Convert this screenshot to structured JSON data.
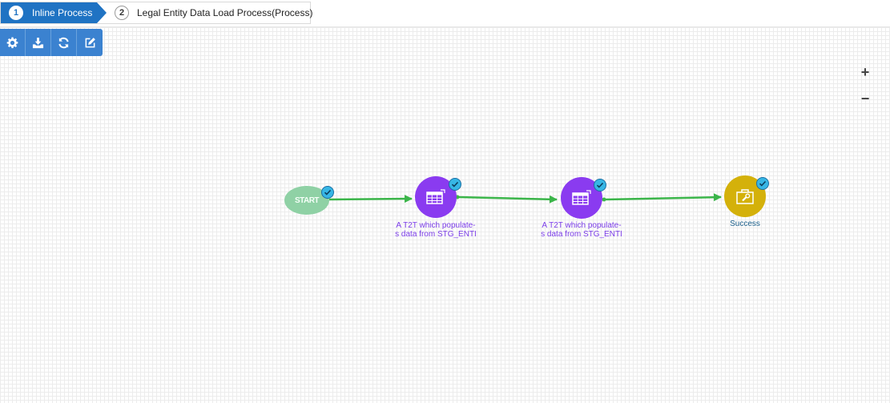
{
  "breadcrumb": {
    "steps": [
      {
        "number": "1",
        "label": "Inline Process"
      },
      {
        "number": "2",
        "label": "Legal Entity Data Load Process(Process)"
      }
    ]
  },
  "toolbar": {
    "buttons": [
      "gear-icon",
      "download-icon",
      "refresh-icon",
      "edit-icon"
    ]
  },
  "zoom": {
    "in_label": "+",
    "out_label": "−"
  },
  "flow": {
    "start_label": "START",
    "tasks": [
      {
        "label_line1": "A T2T which populate-",
        "label_line2": "s data from STG_ENTI"
      },
      {
        "label_line1": "A T2T which populate-",
        "label_line2": "s data from STG_ENTI"
      }
    ],
    "end_label": "Success"
  },
  "colors": {
    "accent": "#1f73c3",
    "toolbar": "#3b82d0",
    "start": "#8fd1a5",
    "task": "#8a3bf0",
    "end": "#d4b10a",
    "edge": "#3bb54a",
    "check": "#37b6e5"
  }
}
